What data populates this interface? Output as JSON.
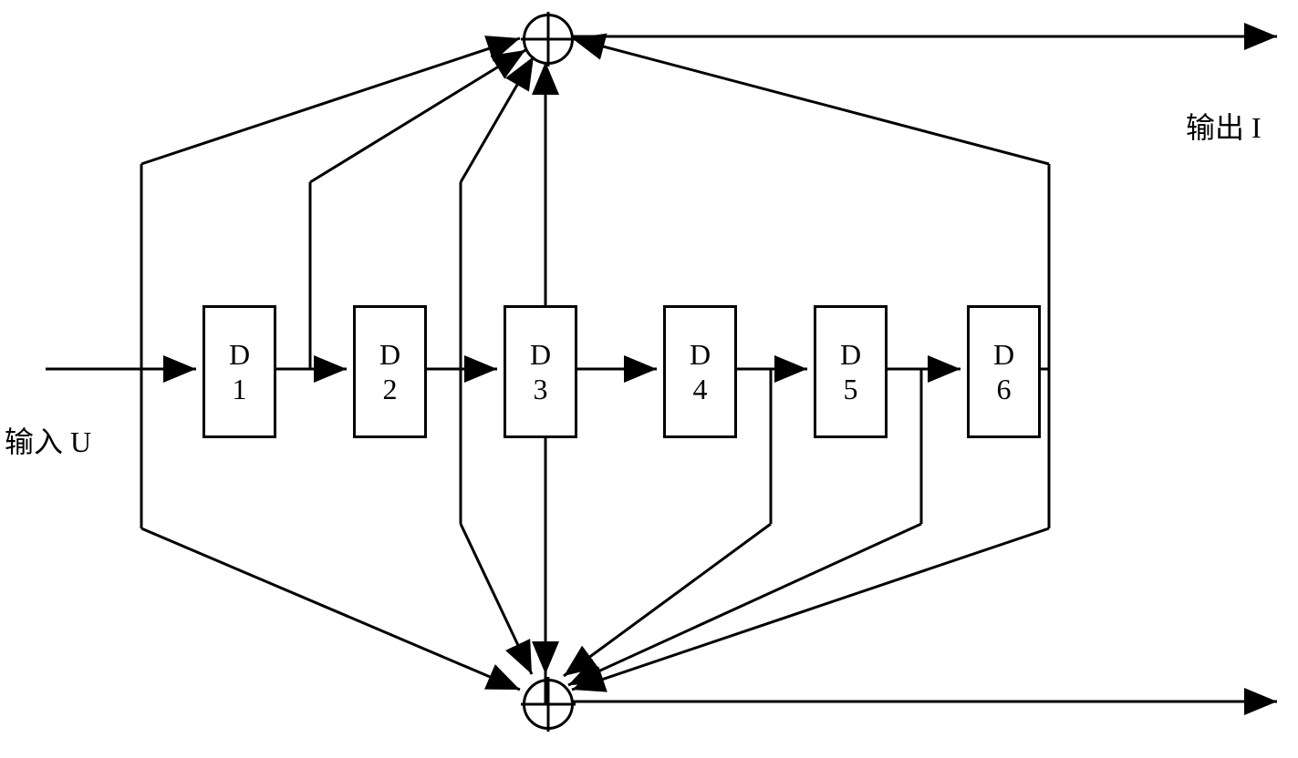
{
  "input_label": "输入 U",
  "output_label": "输出 I",
  "blocks": {
    "d1": {
      "line1": "D",
      "line2": "1"
    },
    "d2": {
      "line1": "D",
      "line2": "2"
    },
    "d3": {
      "line1": "D",
      "line2": "3"
    },
    "d4": {
      "line1": "D",
      "line2": "4"
    },
    "d5": {
      "line1": "D",
      "line2": "5"
    },
    "d6": {
      "line1": "D",
      "line2": "6"
    }
  },
  "chart_data": {
    "type": "block-diagram",
    "description": "Convolutional encoder / shift register diagram with 6 delay elements (D1-D6). Input U feeds into D1. Delay elements connected in series D1->D2->D3->D4->D5->D6. Two XOR (modulo-2 adder) outputs: top XOR produces Output I, taking taps from input, after D1, after D2, after D3, and after D6. Bottom XOR produces second output, taking taps from input, after D2, after D3, after D4, after D5, and after D6.",
    "elements": {
      "input": "U",
      "delays": [
        "D1",
        "D2",
        "D3",
        "D4",
        "D5",
        "D6"
      ],
      "xor_nodes": 2,
      "top_xor_taps": [
        "input",
        "D1_out",
        "D2_out",
        "D3_out",
        "D6_out"
      ],
      "bottom_xor_taps": [
        "input",
        "D2_out",
        "D3_out",
        "D4_out",
        "D5_out",
        "D6_out"
      ],
      "outputs": [
        "I (top)",
        "second output (bottom)"
      ]
    }
  }
}
